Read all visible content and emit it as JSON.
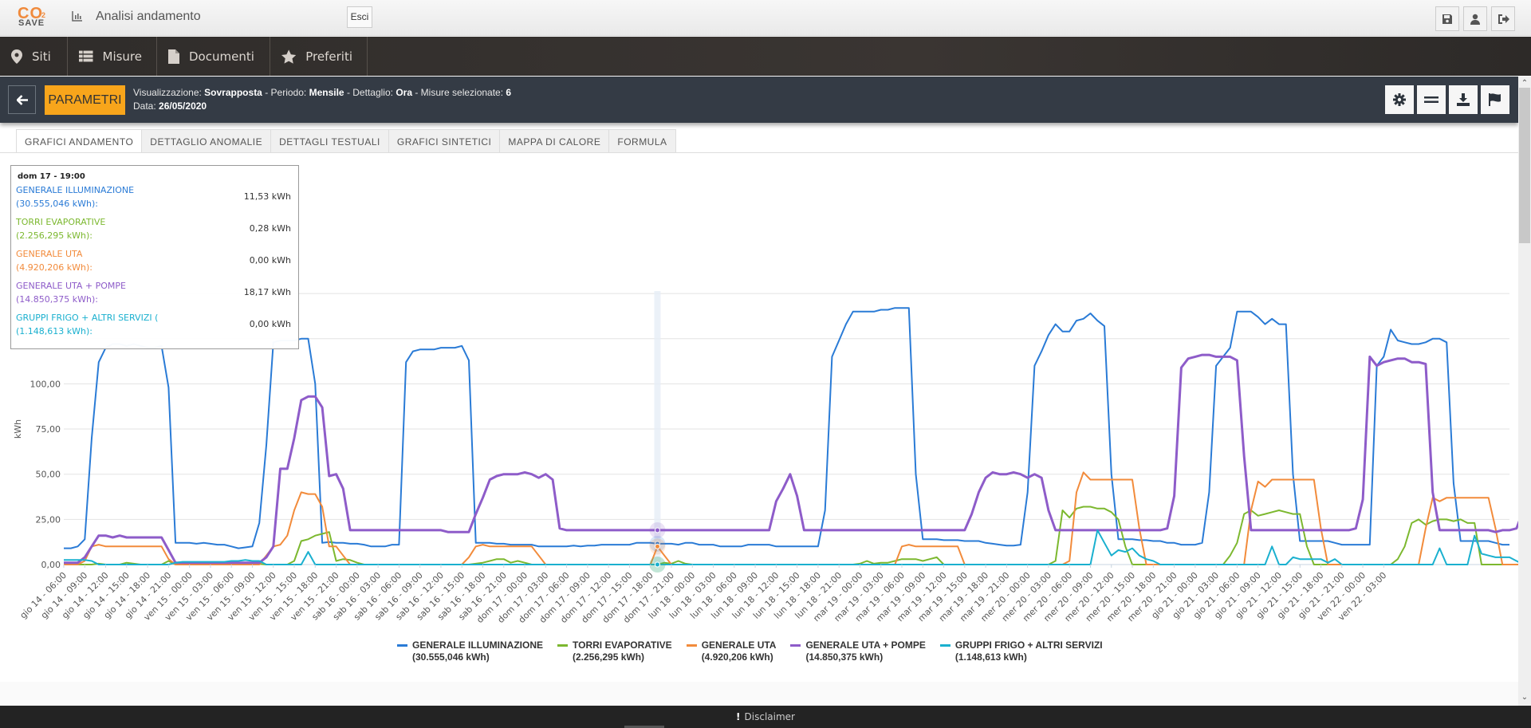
{
  "header": {
    "logo_top": "CO",
    "logo_sub": "2",
    "logo_bottom": "SAVE",
    "title": "Analisi andamento",
    "esci_label": "Esci",
    "icons": [
      "save-icon",
      "user-icon",
      "logout-icon"
    ]
  },
  "nav": {
    "items": [
      {
        "label": "Siti",
        "icon": "map-marker-icon"
      },
      {
        "label": "Misure",
        "icon": "list-icon"
      },
      {
        "label": "Documenti",
        "icon": "document-icon"
      },
      {
        "label": "Preferiti",
        "icon": "star-icon"
      }
    ]
  },
  "params": {
    "button_label": "PARAMETRI",
    "visualizzazione_label": "Visualizzazione:",
    "visualizzazione": "Sovrapposta",
    "periodo_label": "- Periodo:",
    "periodo": "Mensile",
    "dettaglio_label": "- Dettaglio:",
    "dettaglio": "Ora",
    "misure_label": "- Misure selezionate:",
    "misure": "6",
    "data_label": "Data:",
    "data": "26/05/2020",
    "tools": [
      "gear-icon",
      "equals-icon",
      "download-icon",
      "flag-icon"
    ]
  },
  "tabs": [
    {
      "label": "GRAFICI ANDAMENTO",
      "active": true
    },
    {
      "label": "DETTAGLIO ANOMALIE"
    },
    {
      "label": "DETTAGLI TESTUALI"
    },
    {
      "label": "GRAFICI SINTETICI"
    },
    {
      "label": "MAPPA DI CALORE"
    },
    {
      "label": "FORMULA"
    }
  ],
  "tooltip": {
    "header": "dom 17 - 19:00",
    "rows": [
      {
        "name": "GENERALE ILLUMINAZIONE",
        "total": "(30.555,046 kWh):",
        "value": "11,53 kWh",
        "color": "#2a7bd6"
      },
      {
        "name": "TORRI EVAPORATIVE",
        "total": "(2.256,295 kWh):",
        "value": "0,28 kWh",
        "color": "#7cb82f"
      },
      {
        "name": "GENERALE UTA",
        "total": "(4.920,206 kWh):",
        "value": "0,00 kWh",
        "color": "#f28b3b"
      },
      {
        "name": "GENERALE UTA + POMPE",
        "total": "(14.850,375 kWh):",
        "value": "18,17 kWh",
        "color": "#8e5cc9"
      },
      {
        "name": "GRUPPI FRIGO + ALTRI SERVIZI (",
        "total": "(1.148,613 kWh):",
        "value": "0,00 kWh",
        "color": "#1ab0cf"
      }
    ]
  },
  "footer": {
    "label": "Disclaimer"
  },
  "chart_data": {
    "type": "line",
    "title": "",
    "xlabel": "",
    "ylabel": "kWh",
    "ylim": [
      0,
      162.5
    ],
    "yticks": [
      "0,00",
      "25,00",
      "50,00",
      "75,00",
      "100,00"
    ],
    "yticks_values": [
      0,
      25,
      50,
      75,
      100,
      125,
      150
    ],
    "grid": true,
    "legend_position": "bottom",
    "x_ticks": [
      "gio 14 - 06:00",
      "gio 14 - 09:00",
      "gio 14 - 12:00",
      "gio 14 - 15:00",
      "gio 14 - 18:00",
      "gio 14 - 21:00",
      "ven 15 - 00:00",
      "ven 15 - 03:00",
      "ven 15 - 06:00",
      "ven 15 - 09:00",
      "ven 15 - 12:00",
      "ven 15 - 15:00",
      "ven 15 - 18:00",
      "ven 15 - 21:00",
      "sab 16 - 00:00",
      "sab 16 - 03:00",
      "sab 16 - 06:00",
      "sab 16 - 09:00",
      "sab 16 - 12:00",
      "sab 16 - 15:00",
      "sab 16 - 18:00",
      "sab 16 - 21:00",
      "dom 17 - 00:00",
      "dom 17 - 03:00",
      "dom 17 - 06:00",
      "dom 17 - 09:00",
      "dom 17 - 12:00",
      "dom 17 - 15:00",
      "dom 17 - 18:00",
      "dom 17 - 21:00",
      "lun 18 - 00:00",
      "lun 18 - 03:00",
      "lun 18 - 06:00",
      "lun 18 - 09:00",
      "lun 18 - 12:00",
      "lun 18 - 15:00",
      "lun 18 - 18:00",
      "lun 18 - 21:00",
      "mar 19 - 00:00",
      "mar 19 - 03:00",
      "mar 19 - 06:00",
      "mar 19 - 09:00",
      "mar 19 - 12:00",
      "mar 19 - 15:00",
      "mar 19 - 18:00",
      "mar 19 - 21:00",
      "mer 20 - 00:00",
      "mer 20 - 03:00",
      "mer 20 - 06:00",
      "mer 20 - 09:00",
      "mer 20 - 12:00",
      "mer 20 - 15:00",
      "mer 20 - 18:00",
      "mer 20 - 21:00",
      "gio 21 - 00:00",
      "gio 21 - 03:00",
      "gio 21 - 06:00",
      "gio 21 - 09:00",
      "gio 21 - 12:00",
      "gio 21 - 15:00",
      "gio 21 - 18:00",
      "gio 21 - 21:00",
      "ven 22 - 00:00",
      "ven 22 - 03:00"
    ],
    "hover_index": 85,
    "series": [
      {
        "name": "GENERALE ILLUMINAZIONE",
        "total": "(30.555,046 kWh)",
        "color": "#2a7bd6",
        "values": [
          9,
          9,
          10,
          14,
          70,
          112,
          120,
          122,
          122,
          121,
          122,
          121,
          120,
          120,
          121,
          98,
          12,
          12,
          12,
          11.5,
          12,
          11.5,
          11,
          11,
          10,
          9,
          9.5,
          10,
          23,
          66,
          123,
          124,
          124,
          124,
          125,
          125,
          100,
          12,
          12.5,
          12,
          12,
          11.5,
          11.5,
          11,
          10,
          10,
          10,
          11,
          11,
          112,
          118,
          119,
          119,
          119,
          120,
          120,
          120,
          121,
          113,
          12,
          12,
          12,
          11.5,
          11.5,
          11,
          11,
          11,
          11,
          10,
          10,
          10,
          10,
          10,
          10.5,
          10,
          10.5,
          10.5,
          11,
          11,
          11,
          11,
          11,
          12,
          12,
          12,
          11.5,
          11.5,
          11.5,
          11,
          12,
          12,
          11,
          11,
          11,
          10,
          10,
          10,
          10,
          11,
          11,
          11,
          11,
          10,
          10,
          10,
          10,
          10,
          10,
          10,
          30,
          115,
          124,
          133,
          140,
          140,
          140,
          140,
          141,
          141,
          142,
          142,
          142,
          50,
          14,
          14,
          14,
          13.5,
          13.5,
          13.5,
          13,
          13,
          13,
          12,
          11.5,
          11,
          10.5,
          10.5,
          11,
          40,
          110,
          118,
          127,
          133,
          129,
          129,
          135,
          136,
          139,
          135,
          132,
          50,
          14,
          14,
          14,
          13.5,
          13.5,
          13,
          13,
          12,
          12,
          11,
          11,
          11,
          12,
          40,
          110,
          115,
          120,
          140,
          140,
          140,
          137,
          133,
          136,
          133,
          133,
          50,
          13,
          13,
          13,
          13,
          13,
          12,
          11,
          11,
          11,
          11,
          11,
          110,
          115,
          130,
          124,
          123,
          122,
          122,
          123,
          125,
          125,
          123,
          45,
          13,
          13,
          13,
          13,
          13,
          12,
          11,
          11
        ]
      },
      {
        "name": "TORRI EVAPORATIVE",
        "total": "(2.256,295 kWh)",
        "color": "#7cb82f",
        "values": [
          0,
          0,
          0,
          0,
          0,
          0.5,
          0,
          0,
          0,
          1,
          0.5,
          0,
          0,
          0,
          0,
          2,
          0,
          0,
          0,
          0,
          0,
          0,
          0,
          0,
          0,
          0,
          0,
          0,
          0.3,
          0,
          0,
          0,
          0,
          2,
          13,
          14,
          16,
          17,
          18,
          2,
          3,
          2.5,
          1,
          0,
          0,
          0,
          0,
          0,
          0,
          0,
          0,
          0,
          0,
          0,
          0,
          0,
          0,
          0,
          0,
          0.5,
          1,
          2,
          3,
          3,
          1,
          2,
          1,
          0,
          0,
          0,
          0,
          0,
          0,
          0,
          0,
          0,
          0,
          0,
          0,
          0,
          0,
          0,
          0,
          0,
          0,
          0,
          1,
          0.5,
          2,
          0.5,
          0,
          0,
          0,
          0,
          0,
          0,
          0,
          0,
          0,
          0,
          0,
          0,
          0,
          0,
          0,
          0,
          0,
          0,
          0,
          0,
          0,
          0,
          0,
          0,
          0.5,
          2,
          0.5,
          1,
          1,
          2,
          3,
          3,
          3,
          2,
          3,
          4,
          0,
          0,
          0,
          0,
          0,
          0,
          0,
          0,
          0,
          0,
          0,
          0,
          0,
          0,
          0,
          0,
          2,
          30,
          26,
          31,
          32,
          32,
          31,
          31,
          29,
          25,
          10,
          0,
          0,
          0,
          0,
          0,
          0,
          0,
          0,
          0,
          0,
          0,
          0,
          0,
          0,
          5,
          12,
          28,
          30,
          27,
          28,
          29,
          30,
          29,
          28,
          28,
          10,
          0,
          0,
          0,
          0,
          0,
          0,
          0,
          0,
          0,
          0,
          0,
          0,
          3,
          10,
          23,
          25,
          22,
          24,
          25,
          25,
          24,
          25,
          23,
          23,
          0,
          0,
          0,
          0,
          0,
          0,
          0,
          0,
          0,
          0,
          0
        ]
      },
      {
        "name": "GENERALE UTA",
        "total": "(4.920,206 kWh)",
        "color": "#f28b3b",
        "values": [
          0,
          0,
          0,
          2,
          10,
          11,
          10,
          10,
          10,
          10,
          10,
          10,
          10,
          10,
          10,
          3,
          0,
          0,
          0,
          0,
          0,
          0,
          0,
          0,
          0,
          0,
          0,
          0,
          0,
          5,
          10,
          11,
          16,
          30,
          40,
          39,
          39,
          32,
          10,
          10,
          5,
          0,
          0,
          0,
          0,
          0,
          0,
          0,
          0,
          0,
          0,
          0,
          0,
          0,
          0,
          0,
          0,
          0,
          4,
          10,
          11,
          10,
          10,
          10,
          10,
          10,
          10,
          10,
          5,
          0,
          0,
          0,
          0,
          0,
          0,
          0,
          0,
          0,
          0,
          0,
          0,
          0,
          0,
          0,
          0,
          10,
          5,
          0,
          0,
          0,
          0,
          0,
          0,
          0,
          0,
          0,
          0,
          0,
          0,
          0,
          0,
          0,
          0,
          0,
          0,
          0,
          0,
          0,
          0,
          0,
          0,
          0,
          0,
          0,
          0,
          0,
          0,
          0,
          0,
          0,
          10,
          11,
          10,
          10,
          10,
          10,
          10,
          10,
          10,
          0,
          0,
          0,
          0,
          0,
          0,
          0,
          0,
          0,
          0,
          0,
          0,
          0,
          0,
          0,
          2,
          40,
          51,
          47,
          47,
          47,
          47,
          47,
          47,
          47,
          20,
          0,
          0,
          0,
          0,
          0,
          0,
          0,
          0,
          0,
          0,
          0,
          0,
          0,
          0,
          0,
          30,
          46,
          43,
          47,
          47,
          47,
          47,
          47,
          47,
          47,
          20,
          0,
          0,
          0,
          0,
          0,
          0,
          0,
          0,
          0,
          0,
          0,
          0,
          0,
          0,
          20,
          37,
          35,
          37,
          37,
          37,
          37,
          37,
          37,
          37,
          20,
          0,
          0,
          0,
          0,
          0,
          0,
          0,
          0,
          0
        ]
      },
      {
        "name": "GENERALE UTA + POMPE",
        "total": "(14.850,375 kWh)",
        "color": "#8e5cc9",
        "values": [
          1,
          1,
          1,
          4,
          10,
          16,
          16,
          15,
          16,
          15,
          15,
          15,
          15,
          15,
          15,
          8,
          1,
          1,
          1,
          1,
          1,
          1,
          1,
          1,
          1,
          1,
          1,
          1,
          1,
          4,
          10,
          53,
          53,
          70,
          91,
          93,
          93,
          87,
          49,
          50,
          42,
          19,
          19,
          19,
          19,
          19,
          19,
          19,
          19,
          19,
          19,
          19,
          19,
          19,
          19,
          18,
          18,
          18,
          18,
          28,
          37,
          47,
          49,
          50,
          50,
          50,
          51,
          50,
          48,
          50,
          47,
          20,
          19,
          19,
          19,
          19,
          19,
          19,
          19,
          19,
          19,
          19,
          19,
          19,
          19,
          19,
          19,
          19,
          19,
          19,
          19,
          19,
          19,
          19,
          19,
          19,
          19,
          19,
          19,
          19,
          19,
          19,
          35,
          42,
          50,
          38,
          19,
          19,
          19,
          19,
          19,
          19,
          19,
          19,
          19,
          19,
          19,
          19,
          19,
          19,
          19,
          19,
          19,
          19,
          19,
          19,
          19,
          19,
          19,
          19,
          28,
          40,
          48,
          51,
          50,
          50,
          51,
          50,
          48,
          50,
          48,
          30,
          19,
          19,
          19,
          19,
          19,
          19,
          19,
          19,
          19,
          19,
          19,
          19,
          19,
          19,
          19,
          19,
          20,
          38,
          109,
          114,
          115,
          116,
          116,
          115,
          115,
          115,
          113,
          60,
          19,
          19,
          19,
          19,
          19,
          19,
          19,
          19,
          19,
          19,
          19,
          19,
          19,
          19,
          19,
          20,
          36,
          115,
          110,
          112,
          113,
          114,
          114,
          112,
          112,
          111,
          40,
          19,
          19,
          19,
          19,
          19,
          19,
          19,
          19,
          18,
          19,
          19,
          20,
          30,
          100,
          98,
          97,
          100,
          100,
          100,
          100,
          99,
          98,
          50,
          19,
          19,
          19,
          19,
          19,
          19,
          19,
          19
        ]
      },
      {
        "name": "GRUPPI FRIGO + ALTRI SERVIZI",
        "total": "(1.148,613 kWh)",
        "color": "#1ab0cf",
        "values": [
          2.5,
          2.5,
          2.5,
          2.5,
          2,
          0,
          0,
          0,
          0,
          0,
          0,
          0,
          0,
          0,
          0,
          0,
          1,
          1.5,
          1.5,
          1.5,
          1.5,
          1.5,
          1.5,
          1.5,
          2,
          2,
          2.5,
          2,
          2,
          0,
          0,
          0,
          0,
          0,
          0,
          7,
          0,
          0,
          0,
          0,
          0,
          0,
          0,
          0,
          0,
          0,
          0,
          0,
          0,
          0,
          0,
          0,
          0,
          0,
          0,
          0,
          0,
          0,
          0,
          0,
          0,
          0,
          0,
          0,
          0,
          0,
          0,
          0,
          0,
          0,
          0,
          0,
          0,
          0,
          0,
          0,
          0,
          0,
          0,
          0,
          0,
          0,
          0,
          0,
          0,
          0,
          0,
          0,
          0,
          0,
          0,
          0,
          0,
          0,
          0,
          0,
          0,
          0,
          0,
          0,
          0,
          0,
          0,
          0,
          0,
          0,
          0,
          0,
          0,
          0,
          0,
          0,
          0,
          0,
          0,
          0,
          0,
          0,
          0,
          0,
          0,
          0,
          0,
          0,
          0,
          0,
          0,
          0,
          0,
          0,
          0,
          0,
          0,
          0,
          0,
          0,
          0,
          0,
          0,
          0,
          0,
          0,
          0,
          0,
          0,
          0,
          0,
          0,
          19,
          12,
          5,
          8,
          7,
          9,
          5,
          3,
          2,
          0,
          0,
          0,
          0,
          0,
          0,
          0,
          0,
          0,
          0,
          0,
          0,
          0,
          0,
          0,
          0,
          10,
          0,
          0,
          4,
          3,
          3,
          3,
          3,
          1,
          3,
          0,
          0,
          0,
          0,
          0,
          0,
          0,
          0,
          0,
          0,
          0,
          0,
          0,
          0,
          9,
          0,
          0,
          0,
          0,
          16,
          6,
          5,
          4,
          4,
          4,
          2,
          0,
          0,
          0,
          0,
          0,
          0,
          0,
          0,
          0,
          0
        ]
      }
    ]
  }
}
